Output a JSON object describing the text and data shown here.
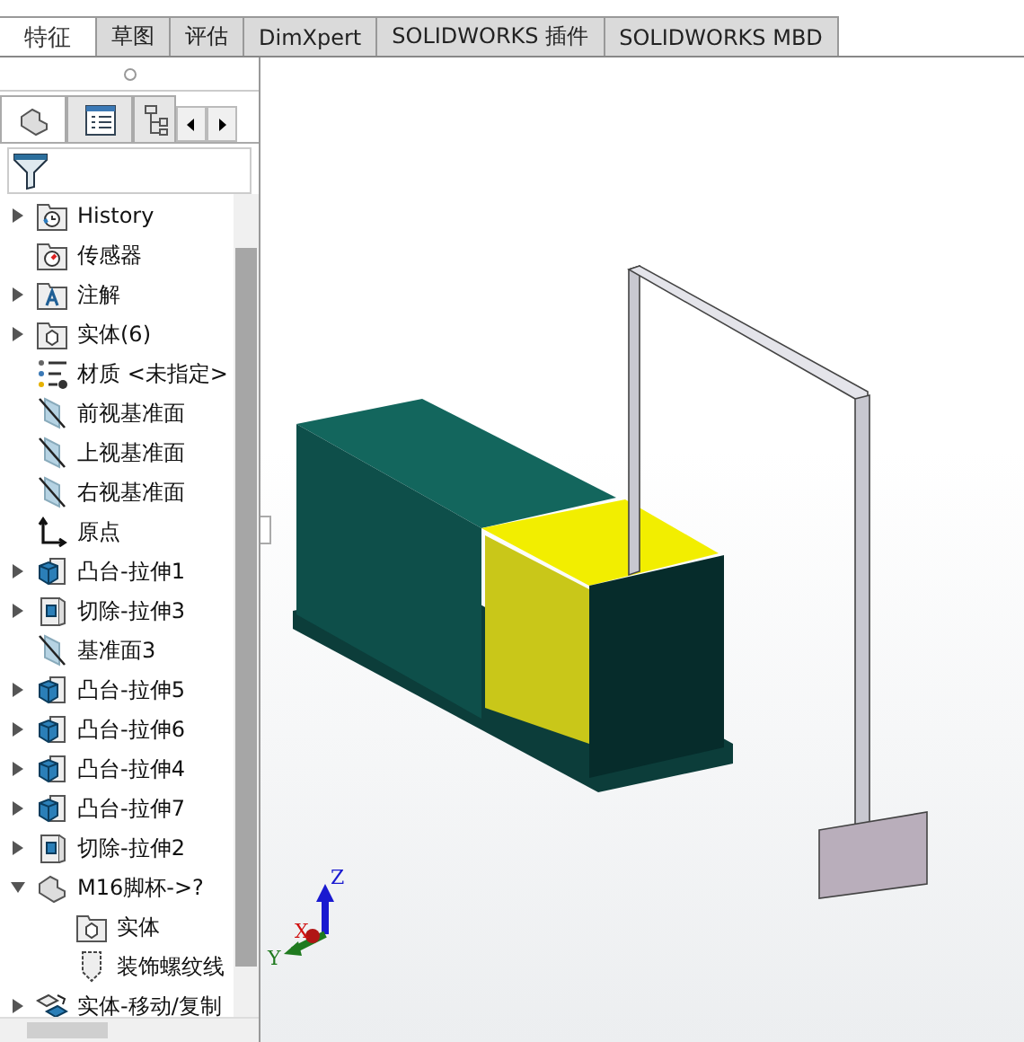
{
  "tabs": [
    {
      "label": "特征",
      "selected": true
    },
    {
      "label": "草图",
      "selected": false
    },
    {
      "label": "评估",
      "selected": false
    },
    {
      "label": "DimXpert",
      "selected": false
    },
    {
      "label": "SOLIDWORKS 插件",
      "selected": false
    },
    {
      "label": "SOLIDWORKS MBD",
      "selected": false
    }
  ],
  "panel_tabs": [
    {
      "kind": "part",
      "selected": true
    },
    {
      "kind": "list",
      "selected": false
    },
    {
      "kind": "config",
      "selected": false
    }
  ],
  "tree": [
    {
      "label": "History",
      "kind": "history",
      "expanded": false
    },
    {
      "label": "传感器",
      "kind": "sensor"
    },
    {
      "label": "注解",
      "kind": "annotation",
      "expanded": false
    },
    {
      "label": "实体(6)",
      "kind": "solid-folder",
      "expanded": false
    },
    {
      "label": "材质 <未指定>",
      "kind": "material"
    },
    {
      "label": "前视基准面",
      "kind": "plane"
    },
    {
      "label": "上视基准面",
      "kind": "plane"
    },
    {
      "label": "右视基准面",
      "kind": "plane"
    },
    {
      "label": "原点",
      "kind": "origin"
    },
    {
      "label": "凸台-拉伸1",
      "kind": "boss",
      "expanded": false
    },
    {
      "label": "切除-拉伸3",
      "kind": "cut",
      "expanded": false
    },
    {
      "label": "基准面3",
      "kind": "plane"
    },
    {
      "label": "凸台-拉伸5",
      "kind": "boss",
      "expanded": false
    },
    {
      "label": "凸台-拉伸6",
      "kind": "boss",
      "expanded": false
    },
    {
      "label": "凸台-拉伸4",
      "kind": "boss",
      "expanded": false
    },
    {
      "label": "凸台-拉伸7",
      "kind": "boss",
      "expanded": false
    },
    {
      "label": "切除-拉伸2",
      "kind": "cut",
      "expanded": false
    },
    {
      "label": "M16脚杯->?",
      "kind": "part",
      "expanded": true,
      "children": [
        {
          "label": "实体",
          "kind": "solid-folder"
        },
        {
          "label": "装饰螺纹线",
          "kind": "thread"
        }
      ]
    },
    {
      "label": "实体-移动/复制",
      "kind": "move",
      "expanded": false
    }
  ],
  "triad": {
    "z": "Z",
    "x": "X",
    "y": "Y"
  }
}
